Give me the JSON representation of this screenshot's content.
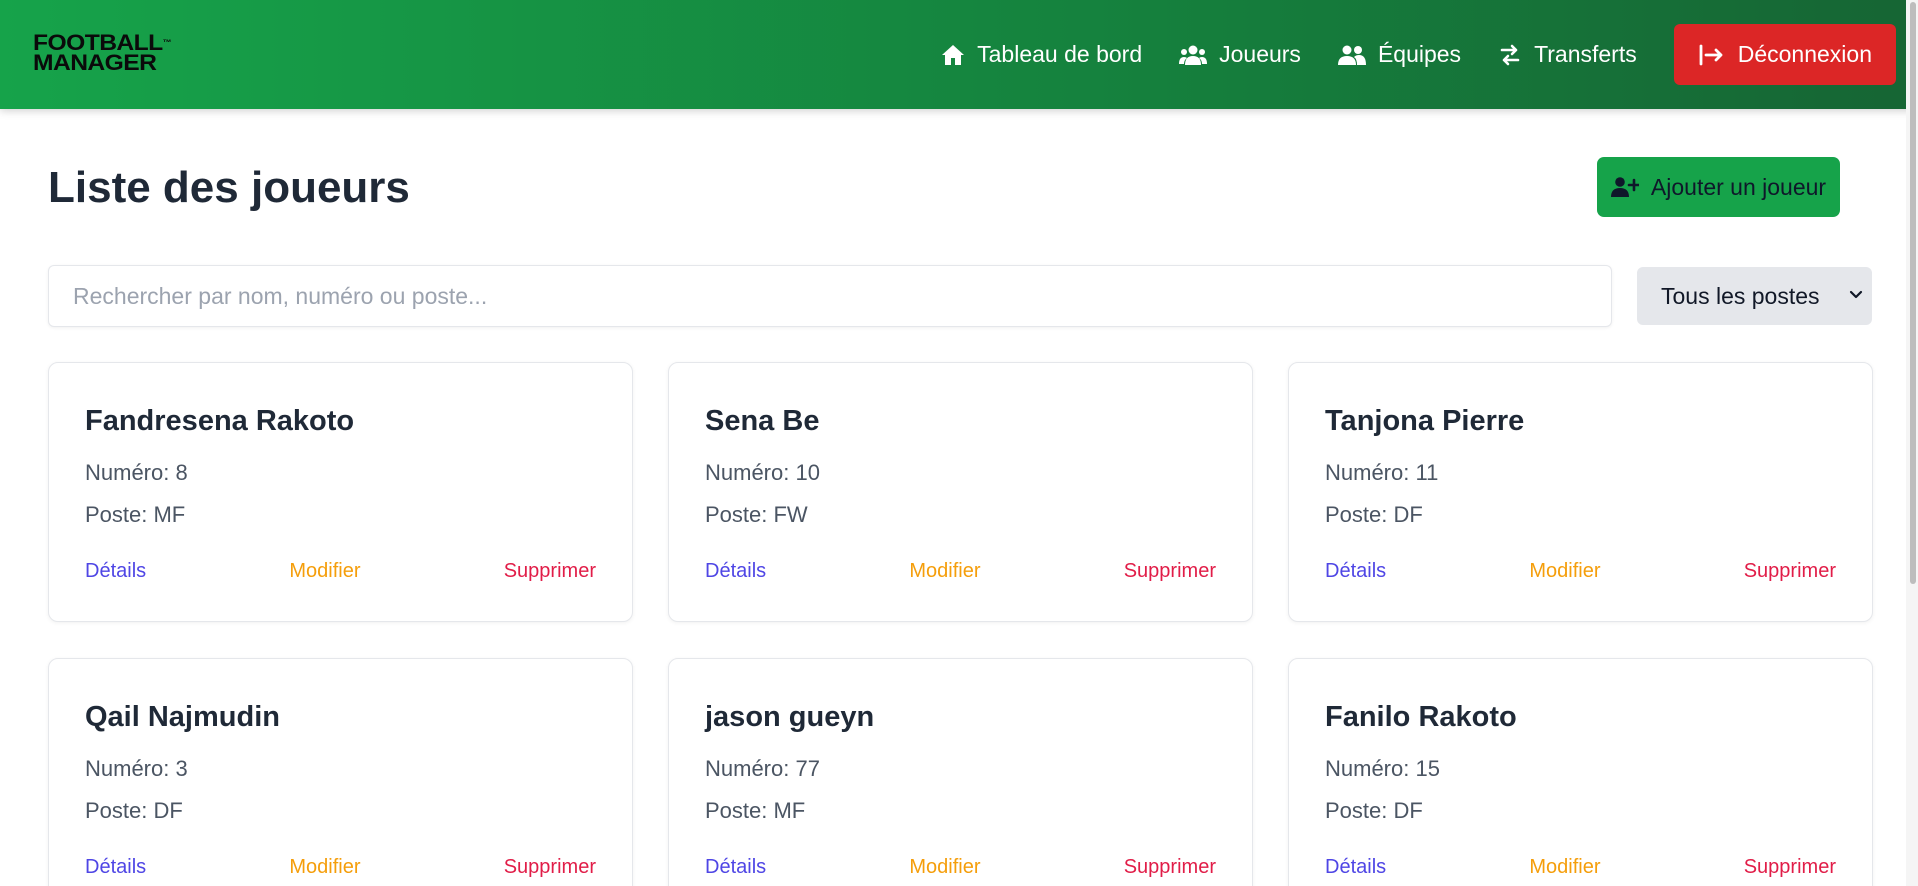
{
  "brand": {
    "line1": "FOOTBALL",
    "line2": "MANAGER",
    "tm": "™"
  },
  "nav": {
    "dashboard": "Tableau de bord",
    "players": "Joueurs",
    "teams": "Équipes",
    "transfers": "Transferts",
    "logout": "Déconnexion"
  },
  "page": {
    "title": "Liste des joueurs",
    "add_button": "Ajouter un joueur"
  },
  "search": {
    "placeholder": "Rechercher par nom, numéro ou poste...",
    "value": ""
  },
  "filter": {
    "selected": "Tous les postes"
  },
  "actions": {
    "details": "Détails",
    "modify": "Modifier",
    "delete": "Supprimer"
  },
  "players": [
    {
      "name": "Fandresena Rakoto",
      "number": "Numéro: 8",
      "position": "Poste: MF"
    },
    {
      "name": "Sena Be",
      "number": "Numéro: 10",
      "position": "Poste: FW"
    },
    {
      "name": "Tanjona Pierre",
      "number": "Numéro: 11",
      "position": "Poste: DF"
    },
    {
      "name": "Qail Najmudin",
      "number": "Numéro: 3",
      "position": "Poste: DF"
    },
    {
      "name": "jason gueyn",
      "number": "Numéro: 77",
      "position": "Poste: MF"
    },
    {
      "name": "Fanilo Rakoto",
      "number": "Numéro: 15",
      "position": "Poste: DF"
    }
  ],
  "colors": {
    "nav_green": "#16a34a",
    "logout_red": "#dc2626",
    "details": "#4f46e5",
    "modify": "#f59e0b",
    "delete": "#e11d48"
  },
  "icons": [
    "home-icon",
    "users-icon",
    "teams-icon",
    "transfer-icon",
    "logout-icon",
    "add-user-icon",
    "chevron-down-icon"
  ]
}
